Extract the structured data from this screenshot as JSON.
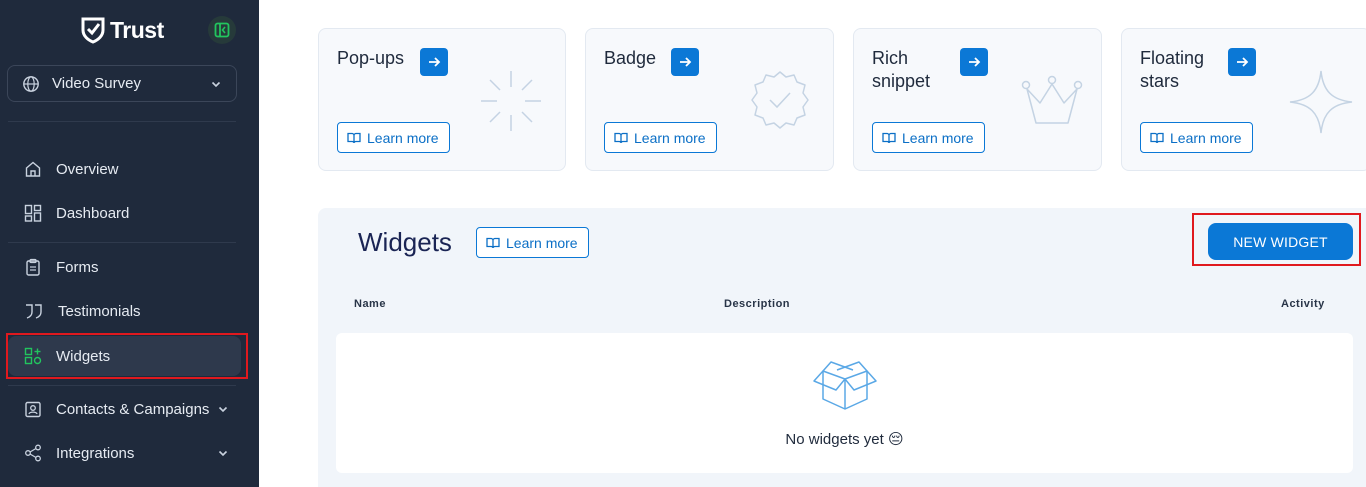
{
  "app": {
    "brand": "Trust"
  },
  "sidebar": {
    "project": "Video Survey",
    "items": [
      {
        "label": "Overview",
        "icon": "home-icon"
      },
      {
        "label": "Dashboard",
        "icon": "dashboard-icon"
      },
      {
        "label": "Forms",
        "icon": "clipboard-icon"
      },
      {
        "label": "Testimonials",
        "icon": "quote-icon"
      },
      {
        "label": "Widgets",
        "icon": "widgets-icon"
      },
      {
        "label": "Contacts & Campaigns",
        "icon": "contact-card-icon"
      },
      {
        "label": "Integrations",
        "icon": "share-icon"
      }
    ]
  },
  "cards": [
    {
      "title": "Pop-ups",
      "learn": "Learn more"
    },
    {
      "title": "Badge",
      "learn": "Learn more"
    },
    {
      "title": "Rich snippet",
      "learn": "Learn more"
    },
    {
      "title": "Floating stars",
      "learn": "Learn more"
    }
  ],
  "widgets": {
    "title": "Widgets",
    "learn": "Learn more",
    "new_button": "NEW WIDGET",
    "columns": [
      "Name",
      "Description",
      "Activity"
    ],
    "empty_text": "No widgets yet 😔"
  },
  "colors": {
    "sidebar": "#1f2a3c",
    "accent": "#0b78d6",
    "highlight": "#e0191e"
  }
}
